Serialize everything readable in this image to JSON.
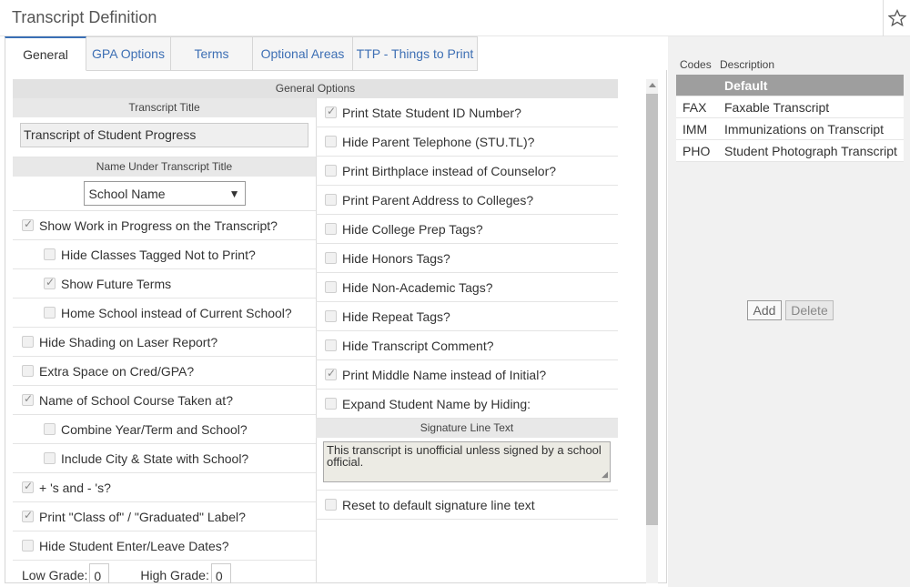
{
  "header": {
    "title": "Transcript Definition"
  },
  "tabs": [
    {
      "label": "General",
      "active": true
    },
    {
      "label": "GPA Options"
    },
    {
      "label": "Terms"
    },
    {
      "label": "Optional Areas"
    },
    {
      "label": "TTP - Things to Print"
    }
  ],
  "general": {
    "section_title": "General Options",
    "transcript_title_label": "Transcript Title",
    "transcript_title_value": "Transcript of Student Progress",
    "name_under_title_label": "Name Under Transcript Title",
    "name_under_title_value": "School Name",
    "left_options": [
      {
        "label": "Show Work in Progress on the Transcript?",
        "checked": true,
        "indent": false
      },
      {
        "label": "Hide Classes Tagged Not to Print?",
        "checked": false,
        "indent": true
      },
      {
        "label": "Show Future Terms",
        "checked": true,
        "indent": true
      },
      {
        "label": "Home School instead of Current School?",
        "checked": false,
        "indent": true
      },
      {
        "label": "Hide Shading on Laser Report?",
        "checked": false,
        "indent": false
      },
      {
        "label": "Extra Space on Cred/GPA?",
        "checked": false,
        "indent": false
      },
      {
        "label": "Name of School Course Taken at?",
        "checked": true,
        "indent": false
      },
      {
        "label": "Combine Year/Term and School?",
        "checked": false,
        "indent": true
      },
      {
        "label": "Include City & State with School?",
        "checked": false,
        "indent": true
      },
      {
        "label": "+ 's and - 's?",
        "checked": true,
        "indent": false
      },
      {
        "label": "Print \"Class of\" / \"Graduated\" Label?",
        "checked": true,
        "indent": false
      },
      {
        "label": "Hide Student Enter/Leave Dates?",
        "checked": false,
        "indent": false
      }
    ],
    "low_grade_label": "Low Grade:",
    "low_grade_value": "0",
    "high_grade_label": "High Grade:",
    "high_grade_value": "0",
    "right_options": [
      {
        "label": "Print State Student ID Number?",
        "checked": true
      },
      {
        "label": "Hide Parent Telephone (STU.TL)?",
        "checked": false
      },
      {
        "label": "Print Birthplace instead of Counselor?",
        "checked": false
      },
      {
        "label": "Print Parent Address to Colleges?",
        "checked": false
      },
      {
        "label": "Hide College Prep Tags?",
        "checked": false
      },
      {
        "label": "Hide Honors Tags?",
        "checked": false
      },
      {
        "label": "Hide Non-Academic Tags?",
        "checked": false
      },
      {
        "label": "Hide Repeat Tags?",
        "checked": false
      },
      {
        "label": "Hide Transcript Comment?",
        "checked": false
      },
      {
        "label": "Print Middle Name instead of Initial?",
        "checked": true
      },
      {
        "label": "Expand Student Name by Hiding:",
        "checked": false
      }
    ],
    "signature_label": "Signature Line Text",
    "signature_text": "This transcript is unofficial unless signed by a school official.",
    "reset_signature_label": "Reset to default signature line text"
  },
  "codes_panel": {
    "col_code": "Codes",
    "col_desc": "Description",
    "rows": [
      {
        "code": "",
        "desc": "Default",
        "selected": true
      },
      {
        "code": "FAX",
        "desc": "Faxable Transcript"
      },
      {
        "code": "IMM",
        "desc": "Immunizations on Transcript"
      },
      {
        "code": "PHO",
        "desc": "Student Photograph Transcript"
      }
    ],
    "add_label": "Add",
    "delete_label": "Delete"
  }
}
